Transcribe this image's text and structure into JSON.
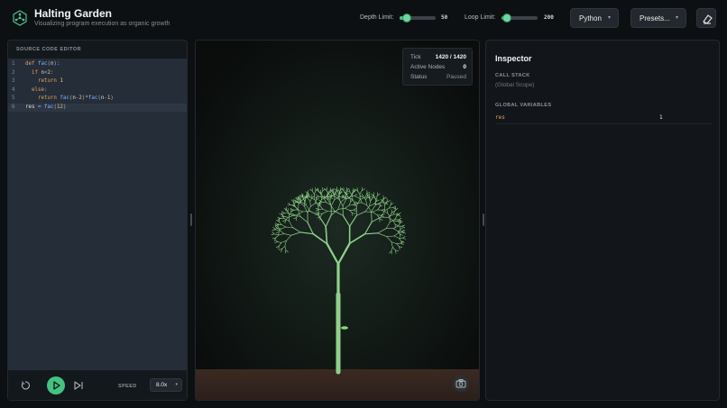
{
  "header": {
    "title": "Halting Garden",
    "subtitle": "Visualizing program execution as organic growth",
    "logo_icon": "hexagon-network-icon",
    "depth_limit": {
      "label": "Depth Limit:",
      "value": "50",
      "fraction": 0.25
    },
    "loop_limit": {
      "label": "Loop Limit:",
      "value": "200",
      "fraction": 0.2
    },
    "language": "Python",
    "presets": "Presets...",
    "clear_icon": "eraser-icon"
  },
  "editor": {
    "heading": "SOURCE CODE EDITOR",
    "lines": [
      {
        "n": "1",
        "text": "def fac(n):"
      },
      {
        "n": "2",
        "text": "  if n<2:"
      },
      {
        "n": "3",
        "text": "    return 1"
      },
      {
        "n": "4",
        "text": "  else:"
      },
      {
        "n": "5",
        "text": "    return fac(n-2)*fac(n-1)"
      },
      {
        "n": "6",
        "text": "res = fac(12)"
      }
    ],
    "active_line": 6,
    "speed_label": "SPEED",
    "speed_value": "8.0x",
    "controls": [
      "reset-icon",
      "play-icon",
      "step-forward-icon"
    ]
  },
  "canvas": {
    "tick_label": "Tick",
    "tick_value": "1420 / 1420",
    "nodes_label": "Active Nodes",
    "nodes_value": "0",
    "status_label": "Status",
    "status_value": "Paused",
    "snapshot_icon": "camera-icon",
    "tree_color": "#8fd18a",
    "soil_color": "#3b2a22"
  },
  "inspector": {
    "title": "Inspector",
    "call_stack_heading": "CALL STACK",
    "scope": "(Global Scope)",
    "globals_heading": "GLOBAL VARIABLES",
    "variables": [
      {
        "name": "res",
        "value": "1"
      }
    ]
  },
  "colors": {
    "accent": "#43c37f",
    "background": "#0d1012",
    "panel": "#12161a"
  }
}
